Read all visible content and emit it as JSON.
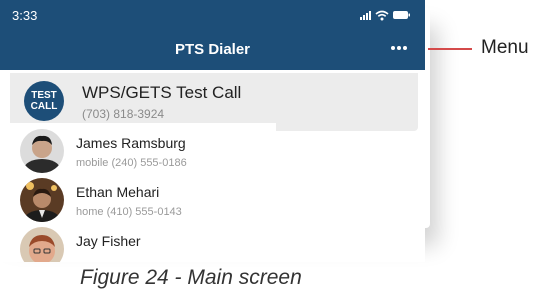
{
  "status_bar": {
    "time": "3:33"
  },
  "app_bar": {
    "title": "PTS Dialer",
    "menu_icon": "more-horizontal-icon"
  },
  "test_call": {
    "badge_line1": "TEST",
    "badge_line2": "CALL",
    "title": "WPS/GETS Test Call",
    "number": "(703) 818-3924"
  },
  "contacts": [
    {
      "name": "James Ramsburg",
      "detail": "mobile  (240) 555-0186"
    },
    {
      "name": "Ethan Mehari",
      "detail": "home  (410) 555-0143"
    },
    {
      "name": "Jay Fisher",
      "detail": ""
    }
  ],
  "callout": {
    "label": "Menu",
    "color": "#d44a4a"
  },
  "caption": "Figure 24 - Main screen",
  "colors": {
    "app_bar": "#1d4e78",
    "card": "#ececec"
  }
}
